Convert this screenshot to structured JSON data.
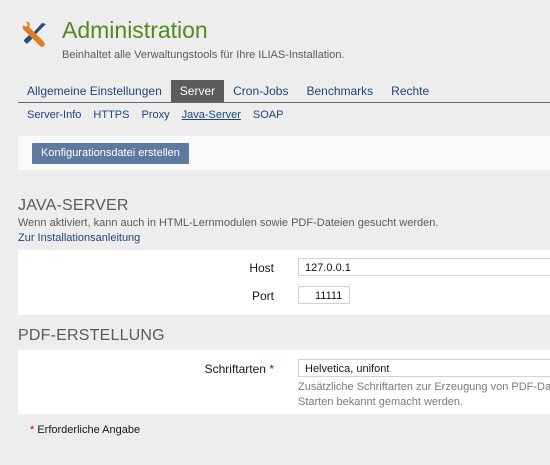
{
  "header": {
    "icon": "tools-icon",
    "title": "Administration",
    "description": "Beinhaltet alle Verwaltungstools für Ihre ILIAS-Installation."
  },
  "tabs": [
    {
      "label": "Allgemeine Einstellungen",
      "active": false
    },
    {
      "label": "Server",
      "active": true
    },
    {
      "label": "Cron-Jobs",
      "active": false
    },
    {
      "label": "Benchmarks",
      "active": false
    },
    {
      "label": "Rechte",
      "active": false
    }
  ],
  "subtabs": [
    {
      "label": "Server-Info",
      "active": false
    },
    {
      "label": "HTTPS",
      "active": false
    },
    {
      "label": "Proxy",
      "active": false
    },
    {
      "label": "Java-Server",
      "active": true
    },
    {
      "label": "SOAP",
      "active": false
    }
  ],
  "toolbar": {
    "button_label": "Konfigurationsdatei erstellen"
  },
  "java_server": {
    "title": "JAVA-SERVER",
    "description": "Wenn aktiviert, kann auch in HTML-Lernmodulen sowie PDF-Dateien gesucht werden.",
    "link": "Zur Installationsanleitung",
    "host_label": "Host",
    "host_value": "127.0.0.1",
    "port_label": "Port",
    "port_value": "11111"
  },
  "pdf": {
    "title": "PDF-ERSTELLUNG",
    "fonts_label": "Schriftarten",
    "required_marker": "*",
    "fonts_value": "Helvetica, unifont",
    "fonts_info_line1": "Zusätzliche Schriftarten zur Erzeugung von PDF-Dateien",
    "fonts_info_line2": "Starten bekannt gemacht werden."
  },
  "footnote": {
    "marker": "*",
    "text": "Erforderliche Angabe"
  },
  "colors": {
    "title_green": "#4f8b1e",
    "link_blue": "#1b467e",
    "button_blue": "#5d7ba1",
    "active_tab": "#5c5c5c",
    "required_red": "#c00000"
  }
}
